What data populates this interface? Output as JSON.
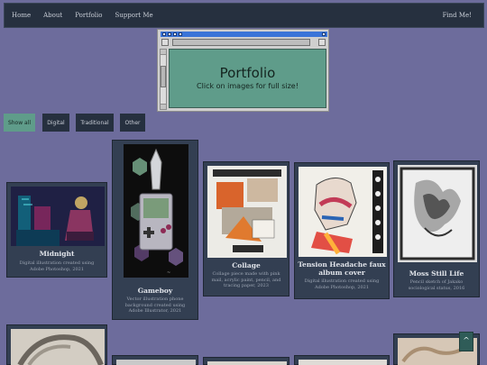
{
  "nav": {
    "links": [
      "Home",
      "About",
      "Portfolio",
      "Support Me"
    ],
    "right_link": "Find Me!"
  },
  "window": {
    "title": "Portfolio",
    "subtitle": "Click on images for full size!"
  },
  "filters": [
    {
      "label": "Show all",
      "active": true
    },
    {
      "label": "Digital",
      "active": false
    },
    {
      "label": "Traditional",
      "active": false
    },
    {
      "label": "Other",
      "active": false
    }
  ],
  "cards": [
    {
      "title": "Midnight",
      "description": "Digital illustration created using Adobe Photoshop, 2021"
    },
    {
      "title": "Gameboy",
      "description": "Vector illustration phone background created using Adobe Illustrator, 2021"
    },
    {
      "title": "Collage",
      "description": "Collage piece made with pink mail, acrylic paint, pencil, and tracing paper, 2023"
    },
    {
      "title": "Tension Headache faux album cover",
      "description": "Digital illustration created using Adobe Photoshop, 2021"
    },
    {
      "title": "Moss Still Life",
      "description": "Pencil sketch of Jakako sociological status, 2016"
    }
  ],
  "back_to_top": "^",
  "colors": {
    "nav_bg": "#26303f",
    "page_bg": "#6d6c9c",
    "card_bg": "#333f52",
    "accent": "#5f9c8a"
  }
}
